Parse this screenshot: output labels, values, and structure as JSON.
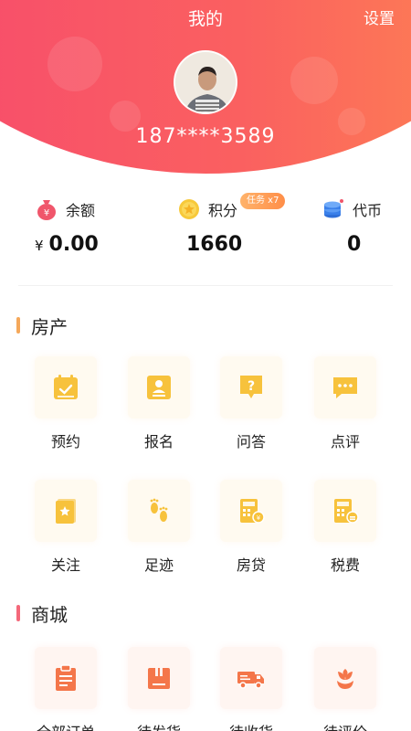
{
  "header": {
    "title": "我的",
    "settings_label": "设置",
    "phone": "187****3589"
  },
  "stats": {
    "balance": {
      "label": "余额",
      "currency": "¥",
      "value": "0.00",
      "icon": "money-bag-icon"
    },
    "points": {
      "label": "积分",
      "value": "1660",
      "icon": "coin-star-icon",
      "badge": "任务 x7"
    },
    "tokens": {
      "label": "代币",
      "value": "0",
      "icon": "coin-stack-icon"
    }
  },
  "sections": {
    "real_estate": {
      "title": "房产",
      "accent": "#f5a85a",
      "items": [
        {
          "label": "预约",
          "icon": "calendar-check-icon"
        },
        {
          "label": "报名",
          "icon": "id-card-icon"
        },
        {
          "label": "问答",
          "icon": "question-bubble-icon"
        },
        {
          "label": "点评",
          "icon": "comment-bubble-icon"
        },
        {
          "label": "关注",
          "icon": "star-bookmark-icon"
        },
        {
          "label": "足迹",
          "icon": "footprints-icon"
        },
        {
          "label": "房贷",
          "icon": "mortgage-calculator-icon"
        },
        {
          "label": "税费",
          "icon": "tax-calculator-icon"
        }
      ]
    },
    "mall": {
      "title": "商城",
      "accent": "#f4687a",
      "items": [
        {
          "label": "全部订单",
          "icon": "order-clipboard-icon"
        },
        {
          "label": "待发货",
          "icon": "package-box-icon"
        },
        {
          "label": "待收货",
          "icon": "delivery-truck-icon"
        },
        {
          "label": "待评价",
          "icon": "flower-review-icon"
        }
      ]
    }
  },
  "colors": {
    "header_start": "#f7476f",
    "header_end": "#ff8a4f",
    "icon_yellow": "#f7c23c",
    "icon_orange": "#f4764a"
  }
}
